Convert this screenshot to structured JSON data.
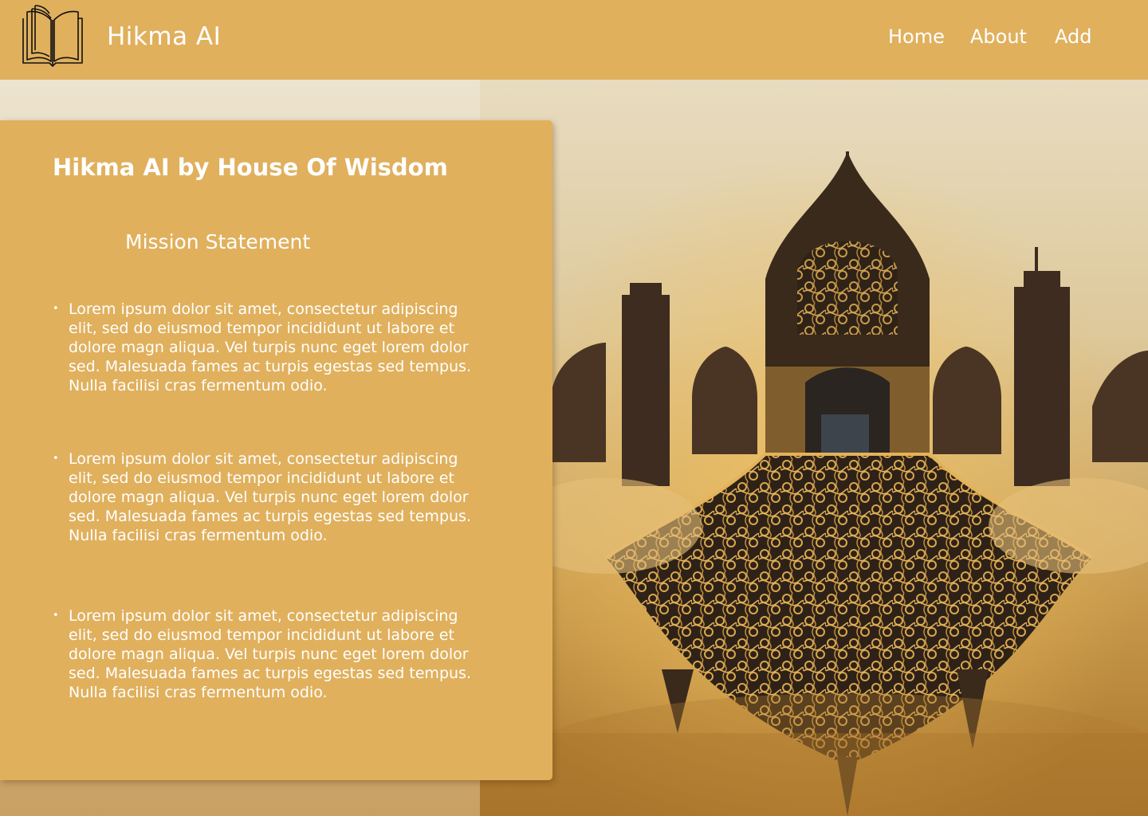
{
  "header": {
    "brand": "Hikma AI",
    "logo_icon": "open-book-icon",
    "nav": [
      "Home",
      "About",
      "Add"
    ]
  },
  "hero": {
    "image": "ornate-domed-mosque-calligraphy-artwork"
  },
  "card": {
    "title": "Hikma AI by House Of Wisdom",
    "subtitle": "Mission Statement",
    "bullets": [
      "Lorem ipsum dolor sit amet, consectetur adipiscing elit, sed do eiusmod tempor incididunt ut labore et dolore magn aliqua. Vel turpis nunc eget lorem dolor sed. Malesuada fames ac turpis egestas sed tempus. Nulla facilisi cras fermentum odio.",
      "Lorem ipsum dolor sit amet, consectetur adipiscing elit, sed do eiusmod tempor incididunt ut labore et dolore magn aliqua. Vel turpis nunc eget lorem dolor sed. Malesuada fames ac turpis egestas sed tempus. Nulla facilisi cras fermentum odio.",
      "Lorem ipsum dolor sit amet, consectetur adipiscing elit, sed do eiusmod tempor incididunt ut labore et dolore magn aliqua. Vel turpis nunc eget lorem dolor sed. Malesuada fames ac turpis egestas sed tempus. Nulla facilisi cras fermentum odio."
    ]
  },
  "colors": {
    "accent": "#e0b05d",
    "text": "#ffffff",
    "dark_ornament": "#2e2218"
  }
}
